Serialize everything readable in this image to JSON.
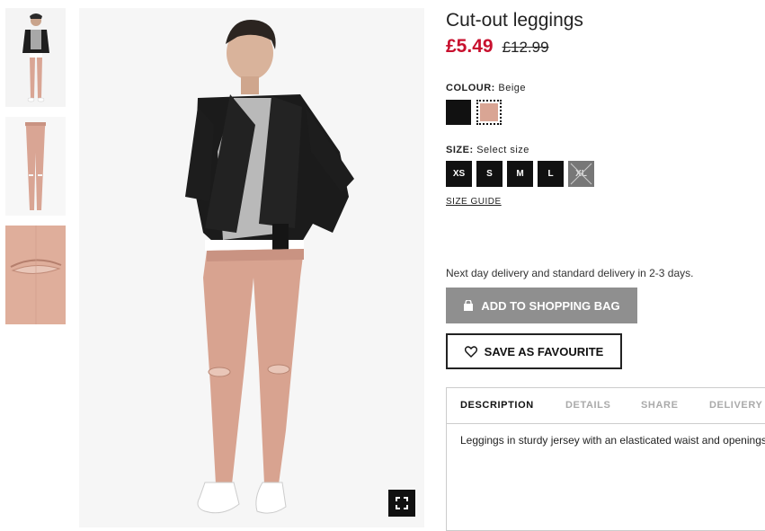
{
  "product": {
    "title": "Cut-out leggings",
    "sale_price": "£5.49",
    "original_price": "£12.99",
    "sale_color": "#c8102e"
  },
  "colour": {
    "label": "COLOUR:",
    "selected": "Beige",
    "swatches": [
      {
        "name": "Black",
        "hex": "#111111"
      },
      {
        "name": "Beige",
        "hex": "#d9a594"
      }
    ]
  },
  "size": {
    "label": "SIZE:",
    "prompt": "Select size",
    "options": [
      {
        "label": "XS",
        "available": true
      },
      {
        "label": "S",
        "available": true
      },
      {
        "label": "M",
        "available": true
      },
      {
        "label": "L",
        "available": true
      },
      {
        "label": "XL",
        "available": false
      }
    ],
    "guide_link": "SIZE GUIDE"
  },
  "delivery_text": "Next day delivery and standard delivery in 2-3 days.",
  "actions": {
    "add_to_bag": "ADD TO SHOPPING BAG",
    "save_favourite": "SAVE AS FAVOURITE"
  },
  "tabs": [
    {
      "label": "DESCRIPTION",
      "active": true
    },
    {
      "label": "DETAILS",
      "active": false
    },
    {
      "label": "SHARE",
      "active": false
    },
    {
      "label": "DELIVERY",
      "active": false
    }
  ],
  "description": "Leggings in sturdy jersey with an elasticated waist and openings",
  "icons": {
    "bag": "shopping-bag-icon",
    "heart": "heart-icon",
    "zoom": "expand-icon"
  }
}
